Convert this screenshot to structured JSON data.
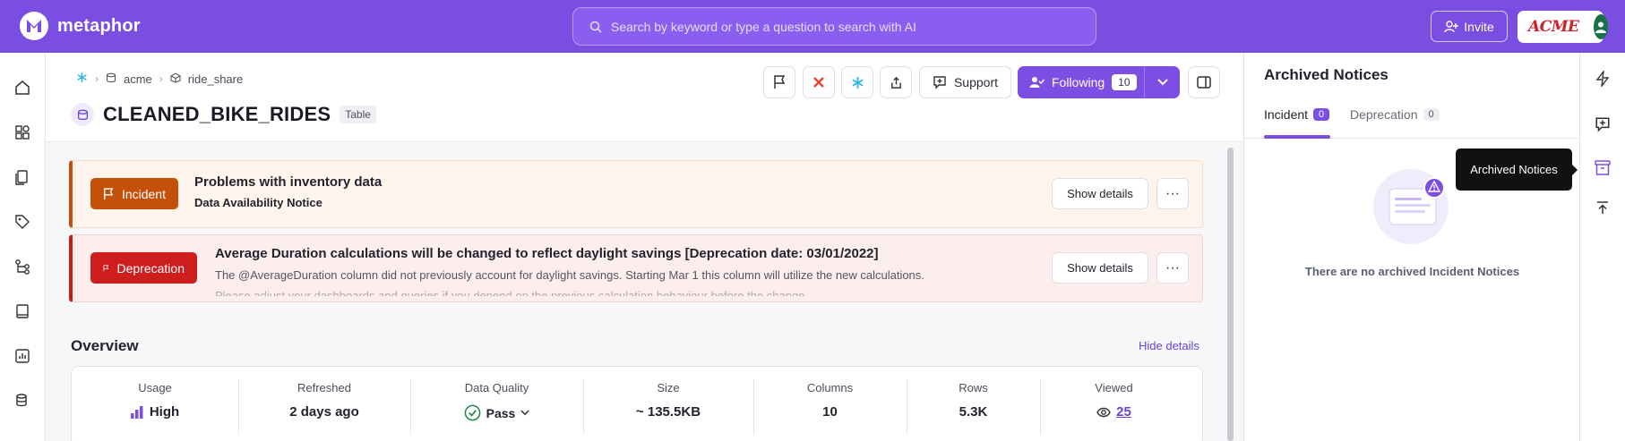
{
  "app": {
    "name": "metaphor"
  },
  "search": {
    "placeholder": "Search by keyword or type a question to search with AI"
  },
  "topbar": {
    "invite_label": "Invite",
    "org_logo_text": "ACME"
  },
  "breadcrumb": {
    "items": [
      "acme",
      "ride_share"
    ]
  },
  "asset": {
    "title": "CLEANED_BIKE_RIDES",
    "type_badge": "Table"
  },
  "header_actions": {
    "support_label": "Support",
    "following_label": "Following",
    "following_count": "10"
  },
  "notices": [
    {
      "tag": "Incident",
      "title": "Problems with inventory data",
      "subtitle": "Data Availability Notice",
      "show_label": "Show details",
      "color": "#c4500a"
    },
    {
      "tag": "Deprecation",
      "title": "Average Duration calculations will be changed to reflect daylight savings [Deprecation date: 03/01/2022]",
      "description": "The @AverageDuration column did not previously account for daylight savings. Starting Mar 1 this column will utilize the new calculations.",
      "description_cut": "Please adjust your dashboards and queries if you depend on the previous calculation behaviour before the change.",
      "show_label": "Show details",
      "color": "#cd1d1d"
    }
  ],
  "overview": {
    "title": "Overview",
    "hide_label": "Hide details",
    "stats": [
      {
        "label": "Usage",
        "value": "High"
      },
      {
        "label": "Refreshed",
        "value": "2 days ago"
      },
      {
        "label": "Data Quality",
        "value": "Pass"
      },
      {
        "label": "Size",
        "value": "~ 135.5KB"
      },
      {
        "label": "Columns",
        "value": "10"
      },
      {
        "label": "Rows",
        "value": "5.3K"
      },
      {
        "label": "Viewed",
        "value": "25"
      }
    ]
  },
  "archived_panel": {
    "title": "Archived Notices",
    "tabs": [
      {
        "label": "Incident",
        "count": "0"
      },
      {
        "label": "Deprecation",
        "count": "0"
      }
    ],
    "empty_text": "There are no archived Incident Notices"
  },
  "tooltip": {
    "text": "Archived Notices"
  },
  "colors": {
    "brand": "#7a4ee0",
    "accent": "#7c4ee4",
    "incident": "#c4500a",
    "deprecation": "#cd1d1d"
  }
}
